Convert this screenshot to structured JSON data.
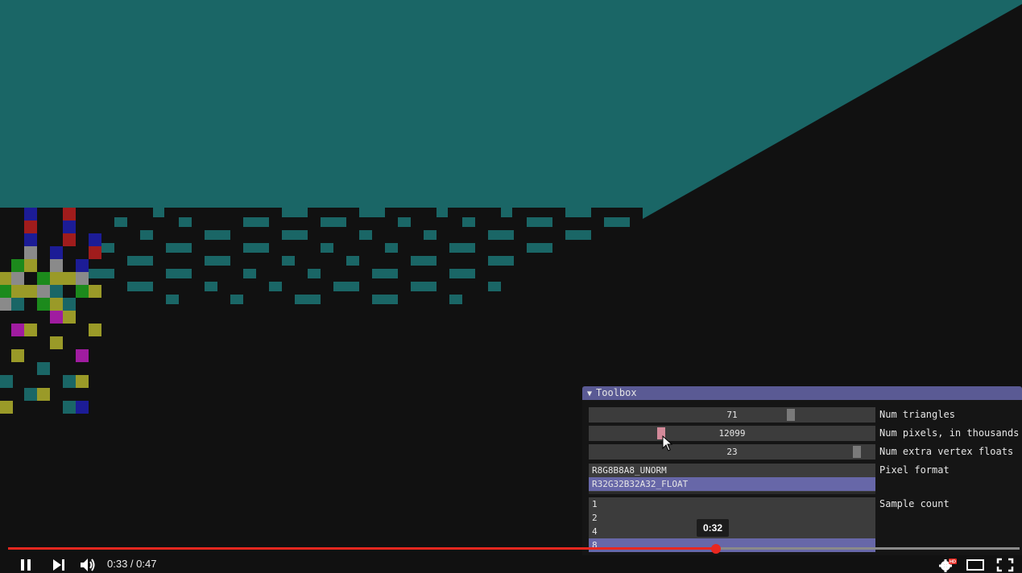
{
  "toolbox": {
    "title": "Toolbox",
    "triangles": {
      "value": "71",
      "label": "Num triangles"
    },
    "pixels": {
      "value": "12099",
      "label": "Num pixels, in thousands"
    },
    "extra": {
      "value": "23",
      "label": "Num extra vertex floats"
    },
    "pixel_format": {
      "label": "Pixel format",
      "options": [
        "R8G8B8A8_UNORM",
        "R32G32B32A32_FLOAT"
      ],
      "selected": "R32G32B32A32_FLOAT"
    },
    "sample_count": {
      "label": "Sample count",
      "options": [
        "1",
        "2",
        "4",
        "8"
      ],
      "selected": "8"
    }
  },
  "player": {
    "time": "0:33 / 0:47",
    "progress": 0.7,
    "hover_time": "0:32",
    "hd_badge": "HD"
  },
  "colors": {
    "teal": "#1a6666",
    "accent": "#e8271f",
    "toolbox_title": "#5a5a94",
    "selection": "#6767a8"
  }
}
